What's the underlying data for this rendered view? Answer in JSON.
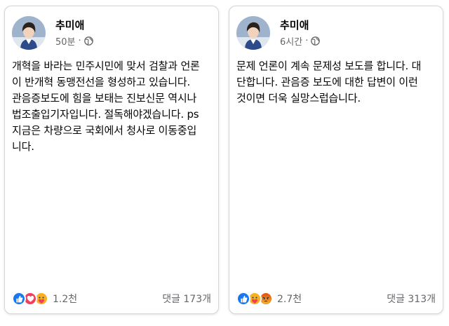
{
  "posts": [
    {
      "author": "추미애",
      "time": "50분",
      "separator": "·",
      "privacy_icon": "globe-icon",
      "text": "개혁을 바라는 민주시민에 맞서 검찰과 언론\n이 반개혁 동맹전선을 형성하고 있습니다.\n관음증보도에 힘을 보태는 진보신문 역시나\n법조출입기자입니다. 절독해야겠습니다. ps\n지금은 차량으로 국회에서 청사로 이동중입\n니다.",
      "reactions": [
        "like-icon",
        "love-icon",
        "care-icon"
      ],
      "reaction_count": "1.2천",
      "comments": "댓글 173개"
    },
    {
      "author": "추미애",
      "time": "6시간",
      "separator": "·",
      "privacy_icon": "globe-icon",
      "text": "문제 언론이 계속 문제성 보도를 합니다. 대\n단합니다. 관음증 보도에 대한 답변이 이런\n것이면 더욱 실망스럽습니다.",
      "reactions": [
        "like-icon",
        "care-icon",
        "angry-icon"
      ],
      "reaction_count": "2.7천",
      "comments": "댓글 313개"
    }
  ],
  "colors": {
    "like": "#1877f2",
    "love": "#f33e58",
    "care": "#f7b125",
    "angry": "#e9710f",
    "meta_text": "#65676b",
    "border": "#d4d6da"
  }
}
